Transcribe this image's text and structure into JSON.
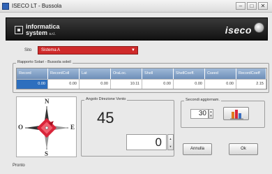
{
  "window": {
    "title": "ISECO LT - Bussola",
    "minimize": "–",
    "maximize": "□",
    "close": "✕"
  },
  "header": {
    "logo_line1": "informatica",
    "logo_line2": "system",
    "logo_suffix": "s.r.l.",
    "brand": "iseco"
  },
  "site": {
    "label": "Sito",
    "selected": "Sistema A"
  },
  "table": {
    "legend": "Rapporto Solari - Bussola soleil",
    "columns": [
      "Record",
      "RecordColl",
      "Lat",
      "OraLoc.",
      "Shell",
      "ShellCoeff.",
      "Cseed",
      "RecordCoeff"
    ],
    "row": [
      "0.00",
      "0.00",
      "0.00",
      "10.11",
      "0.00",
      "0.00",
      "0.00",
      "2.15"
    ]
  },
  "compass": {
    "n": "N",
    "s": "S",
    "e": "E",
    "o": "O",
    "heading_deg": 45
  },
  "direction": {
    "legend": "Angolo Direzione Vento",
    "value": "45",
    "input_value": "0"
  },
  "refresh": {
    "legend": "Secondi aggiornam.",
    "value": "30"
  },
  "buttons": {
    "cancel_label": "Annulla",
    "ok_label": "Ok"
  },
  "status": {
    "text": "Pronto"
  },
  "colors": {
    "accent": "#cf2a2a",
    "selection": "#2d6fbe",
    "header_bg": "#1c1c1c"
  }
}
